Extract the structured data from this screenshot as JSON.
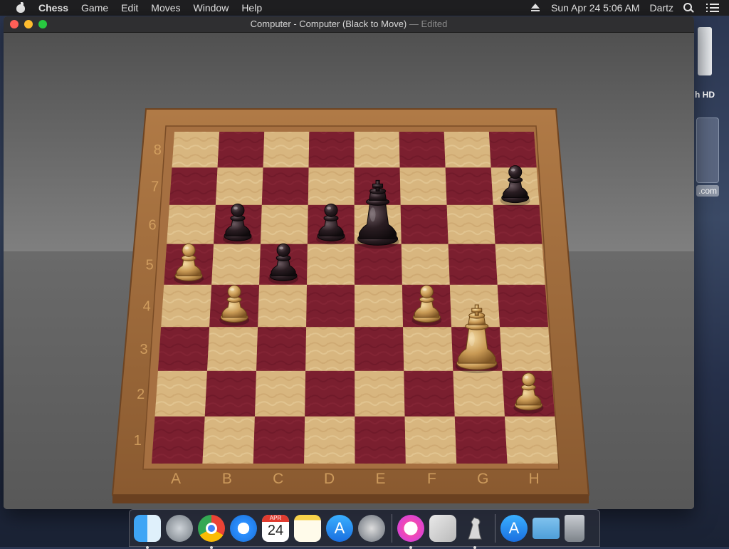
{
  "menubar": {
    "app_name": "Chess",
    "items": [
      "Game",
      "Edit",
      "Moves",
      "Window",
      "Help"
    ],
    "clock": "Sun Apr 24  5:06 AM",
    "user": "Dartz"
  },
  "desktop": {
    "hd_label": "h HD",
    "app_label": ".com"
  },
  "window": {
    "title_main": "Computer - Computer   (Black to Move)",
    "title_suffix": " — Edited"
  },
  "board": {
    "files": [
      "A",
      "B",
      "C",
      "D",
      "E",
      "F",
      "G",
      "H"
    ],
    "ranks": [
      "8",
      "7",
      "6",
      "5",
      "4",
      "3",
      "2",
      "1"
    ],
    "light_square": "#d9b882",
    "dark_square": "#7a1f2e",
    "frame_color": "#9c6a3c",
    "pieces": [
      {
        "color": "black",
        "type": "pawn",
        "square": "H7"
      },
      {
        "color": "black",
        "type": "king",
        "square": "E6"
      },
      {
        "color": "black",
        "type": "pawn",
        "square": "B6"
      },
      {
        "color": "black",
        "type": "pawn",
        "square": "D6"
      },
      {
        "color": "black",
        "type": "pawn",
        "square": "C5"
      },
      {
        "color": "white",
        "type": "pawn",
        "square": "A5"
      },
      {
        "color": "white",
        "type": "pawn",
        "square": "B4"
      },
      {
        "color": "white",
        "type": "pawn",
        "square": "F4"
      },
      {
        "color": "white",
        "type": "king",
        "square": "G3"
      },
      {
        "color": "white",
        "type": "pawn",
        "square": "H2"
      }
    ]
  },
  "dock": {
    "calendar_month": "APR",
    "calendar_day": "24"
  }
}
